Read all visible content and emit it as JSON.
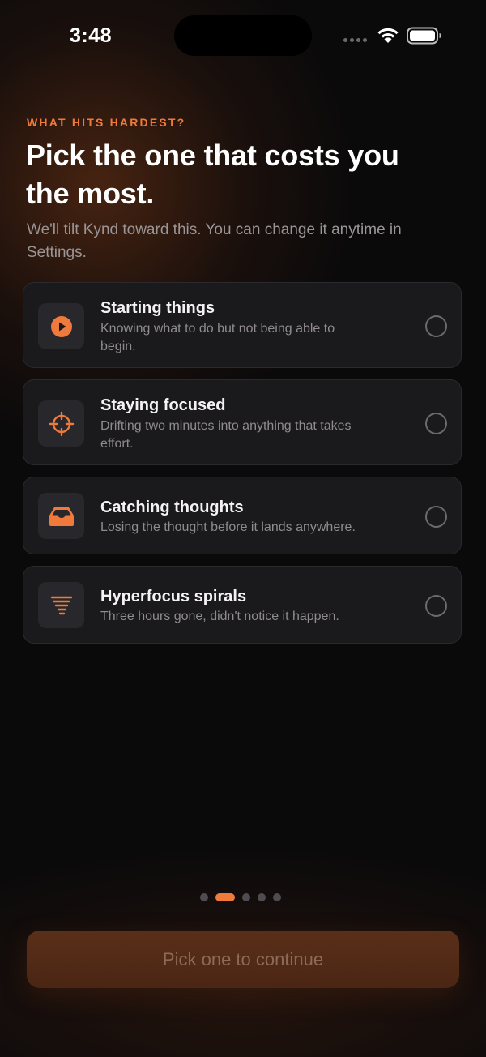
{
  "status_bar": {
    "time": "3:48"
  },
  "header": {
    "eyebrow": "WHAT HITS HARDEST?",
    "title": "Pick the one that costs you the most.",
    "subtitle": "We'll tilt Kynd toward this. You can change it anytime in Settings."
  },
  "options": [
    {
      "icon": "play-icon",
      "title": "Starting things",
      "description": "Knowing what to do but not being able to begin.",
      "selected": false
    },
    {
      "icon": "crosshair-icon",
      "title": "Staying focused",
      "description": "Drifting two minutes into anything that takes effort.",
      "selected": false
    },
    {
      "icon": "inbox-tray-icon",
      "title": "Catching thoughts",
      "description": "Losing the thought before it lands anywhere.",
      "selected": false
    },
    {
      "icon": "tornado-icon",
      "title": "Hyperfocus spirals",
      "description": "Three hours gone, didn't notice it happen.",
      "selected": false
    }
  ],
  "pager": {
    "total": 5,
    "active_index": 1
  },
  "cta": {
    "label": "Pick one to continue",
    "enabled": false
  },
  "colors": {
    "accent": "#f07a3c",
    "background": "#0b0a0b",
    "card": "#1a191c"
  }
}
